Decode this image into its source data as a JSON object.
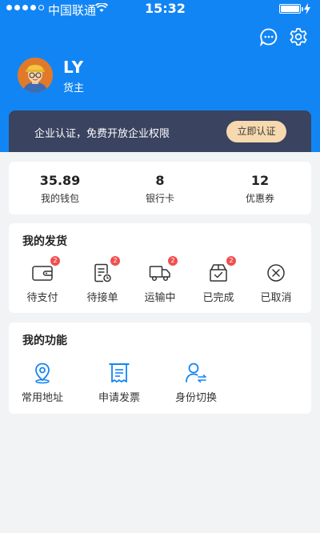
{
  "status_bar": {
    "carrier": "中国联通",
    "time": "15:32"
  },
  "header": {
    "icons": [
      "message-icon",
      "settings-icon"
    ],
    "username": "LY",
    "role": "货主"
  },
  "certification": {
    "text": "企业认证，免费开放企业权限",
    "button_label": "立即认证"
  },
  "wallet": {
    "items": [
      {
        "value": "35.89",
        "label": "我的钱包"
      },
      {
        "value": "8",
        "label": "银行卡"
      },
      {
        "value": "12",
        "label": "优惠券"
      }
    ]
  },
  "shipments": {
    "title": "我的发货",
    "items": [
      {
        "label": "待支付",
        "badge": "2",
        "icon": "wallet-icon"
      },
      {
        "label": "待接单",
        "badge": "2",
        "icon": "order-list-icon"
      },
      {
        "label": "运输中",
        "badge": "2",
        "icon": "truck-icon"
      },
      {
        "label": "已完成",
        "badge": "2",
        "icon": "box-check-icon"
      },
      {
        "label": "已取消",
        "icon": "cancel-circle-icon"
      }
    ]
  },
  "functions": {
    "title": "我的功能",
    "items": [
      {
        "label": "常用地址",
        "icon": "location-pin-icon"
      },
      {
        "label": "申请发票",
        "icon": "invoice-icon"
      },
      {
        "label": "身份切换",
        "icon": "switch-user-icon"
      }
    ]
  },
  "colors": {
    "primary": "#1285f4",
    "banner": "#3a4360",
    "cert_button": "#f6d9ae",
    "badge": "#f05050",
    "background": "#f2f3f5"
  }
}
